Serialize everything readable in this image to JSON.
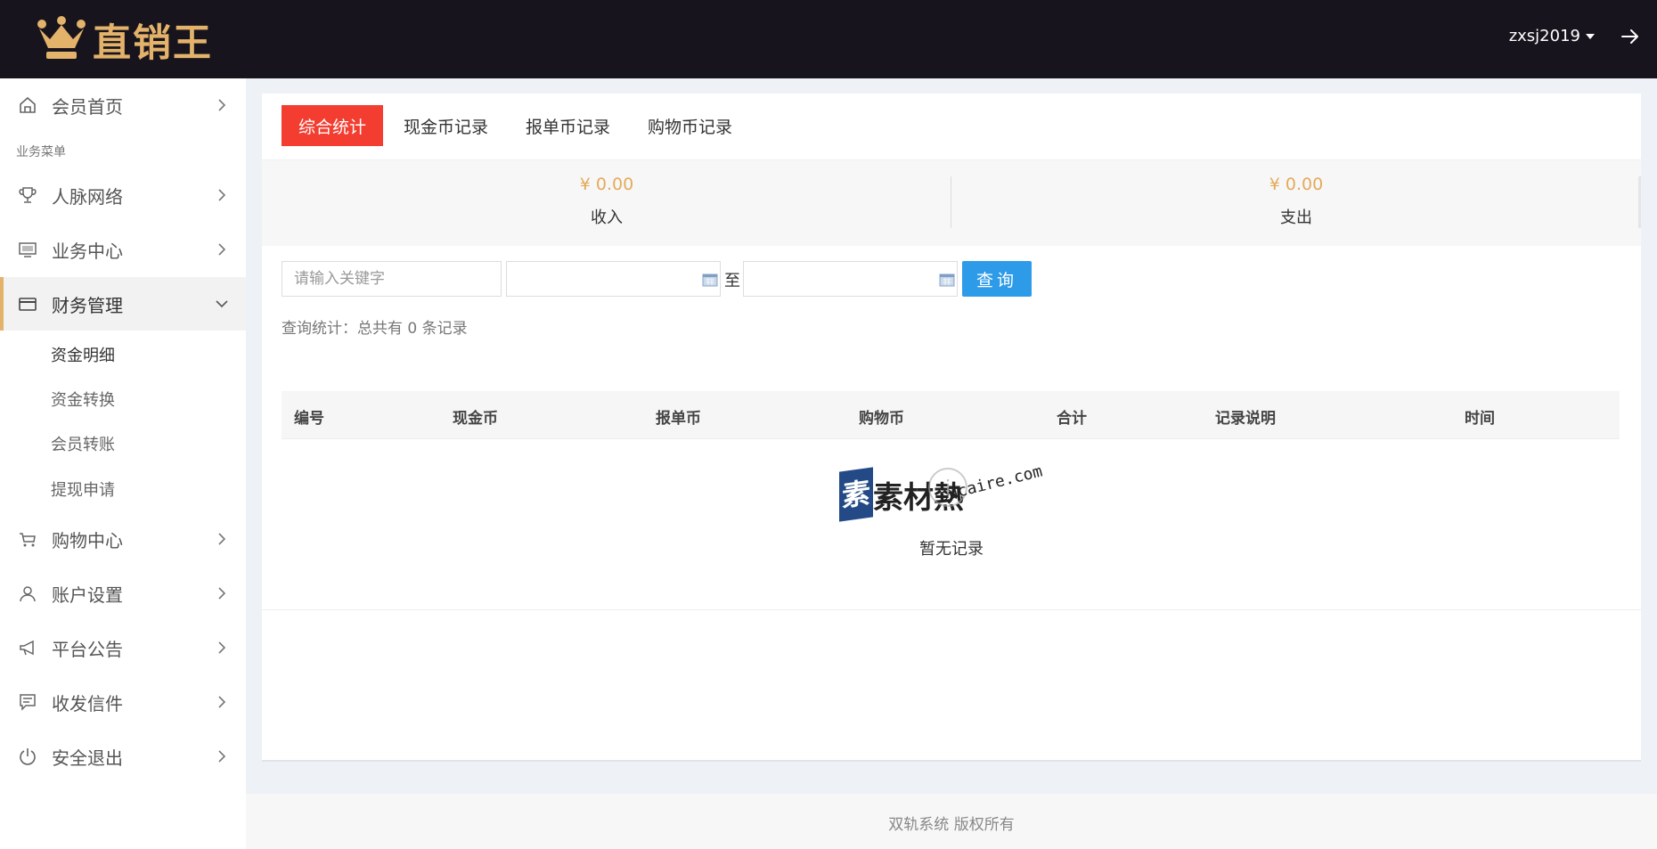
{
  "header": {
    "logo_text": "直销王",
    "username": "zxsj2019",
    "brand_color": "#e3b26b"
  },
  "sidebar": {
    "home": {
      "label": "会员首页",
      "icon": "home-icon"
    },
    "section_title": "业务菜单",
    "items": [
      {
        "label": "人脉网络",
        "icon": "trophy-icon"
      },
      {
        "label": "业务中心",
        "icon": "monitor-icon"
      },
      {
        "label": "财务管理",
        "icon": "card-icon",
        "active": true
      },
      {
        "label": "购物中心",
        "icon": "cart-icon"
      },
      {
        "label": "账户设置",
        "icon": "user-icon"
      },
      {
        "label": "平台公告",
        "icon": "megaphone-icon"
      },
      {
        "label": "收发信件",
        "icon": "message-icon"
      },
      {
        "label": "安全退出",
        "icon": "power-icon"
      }
    ],
    "finance_sub": [
      "资金明细",
      "资金转换",
      "会员转账",
      "提现申请"
    ]
  },
  "tabs": [
    {
      "label": "综合统计",
      "active": true
    },
    {
      "label": "现金币记录"
    },
    {
      "label": "报单币记录"
    },
    {
      "label": "购物币记录"
    }
  ],
  "stats": {
    "income": {
      "amount": "¥ 0.00",
      "label": "收入"
    },
    "expense": {
      "amount": "¥ 0.00",
      "label": "支出"
    },
    "amount_color": "#e3ab5b"
  },
  "filter": {
    "keyword_placeholder": "请输入关键字",
    "to_label": "至",
    "query_label": "查询",
    "query_color": "#2e9be8"
  },
  "summary": "查询统计：总共有 0 条记录",
  "table": {
    "columns": [
      "编号",
      "现金币",
      "报单币",
      "购物币",
      "合计",
      "记录说明",
      "时间"
    ],
    "empty_text": "暂无记录"
  },
  "watermark": {
    "cn": "素材熱",
    "en": "sucaire.com"
  },
  "footer": "双轨系统 版权所有",
  "accent_color": "#f23d30"
}
